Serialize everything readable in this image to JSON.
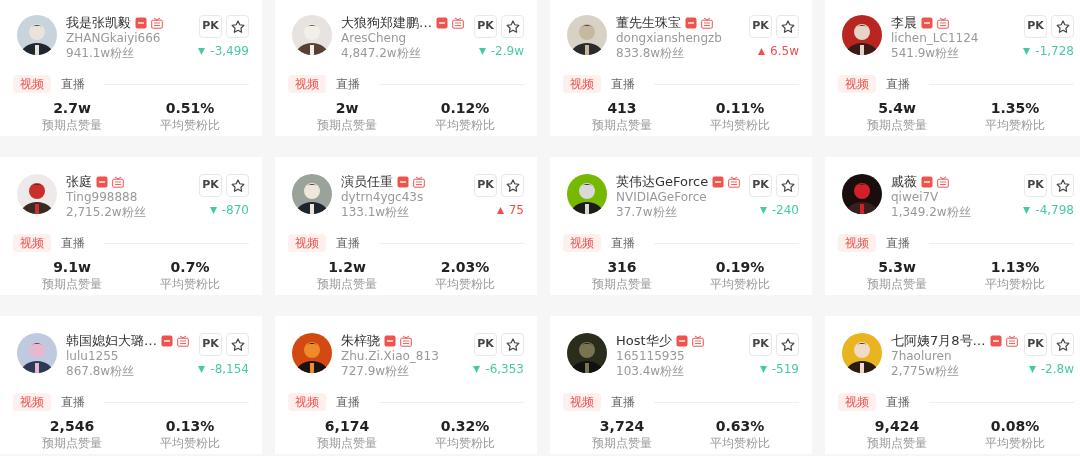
{
  "cards": [
    {
      "name": "我是张凯毅",
      "username": "ZHANGkaiyi666",
      "followers": "941.1w粉丝",
      "pk": "PK",
      "trend": {
        "rising": false,
        "value": "-3,499"
      },
      "tabs": [
        {
          "label": "视频",
          "selected": true
        },
        {
          "label": "直播",
          "selected": false
        }
      ],
      "stats": [
        {
          "value": "2.7w",
          "label": "预期点赞量"
        },
        {
          "value": "0.51%",
          "label": "平均赞粉比"
        }
      ]
    },
    {
      "name": "大狼狗郑建鹏…",
      "username": "AresCheng",
      "followers": "4,847.2w粉丝",
      "pk": "PK",
      "trend": {
        "rising": false,
        "value": "-2.9w"
      },
      "tabs": [
        {
          "label": "视频",
          "selected": true
        },
        {
          "label": "直播",
          "selected": false
        }
      ],
      "stats": [
        {
          "value": "2w",
          "label": "预期点赞量"
        },
        {
          "value": "0.12%",
          "label": "平均赞粉比"
        }
      ]
    },
    {
      "name": "董先生珠宝",
      "username": "dongxianshengzb",
      "followers": "833.8w粉丝",
      "pk": "PK",
      "trend": {
        "rising": true,
        "value": "6.5w"
      },
      "tabs": [
        {
          "label": "视频",
          "selected": true
        },
        {
          "label": "直播",
          "selected": false
        }
      ],
      "stats": [
        {
          "value": "413",
          "label": "预期点赞量"
        },
        {
          "value": "0.11%",
          "label": "平均赞粉比"
        }
      ]
    },
    {
      "name": "李晨",
      "username": "lichen_LC1124",
      "followers": "541.9w粉丝",
      "pk": "PK",
      "trend": {
        "rising": false,
        "value": "-1,728"
      },
      "tabs": [
        {
          "label": "视频",
          "selected": true
        },
        {
          "label": "直播",
          "selected": false
        }
      ],
      "stats": [
        {
          "value": "5.4w",
          "label": "预期点赞量"
        },
        {
          "value": "1.35%",
          "label": "平均赞粉比"
        }
      ]
    },
    {
      "name": "张庭",
      "username": "Ting998888",
      "followers": "2,715.2w粉丝",
      "pk": "PK",
      "trend": {
        "rising": false,
        "value": "-870"
      },
      "tabs": [
        {
          "label": "视频",
          "selected": true
        },
        {
          "label": "直播",
          "selected": false
        }
      ],
      "stats": [
        {
          "value": "9.1w",
          "label": "预期点赞量"
        },
        {
          "value": "0.7%",
          "label": "平均赞粉比"
        }
      ]
    },
    {
      "name": "演员任重",
      "username": "dytrn4ygc43s",
      "followers": "133.1w粉丝",
      "pk": "PK",
      "trend": {
        "rising": true,
        "value": "75"
      },
      "tabs": [
        {
          "label": "视频",
          "selected": true
        },
        {
          "label": "直播",
          "selected": false
        }
      ],
      "stats": [
        {
          "value": "1.2w",
          "label": "预期点赞量"
        },
        {
          "value": "2.03%",
          "label": "平均赞粉比"
        }
      ]
    },
    {
      "name": "英伟达GeForce",
      "username": "NVIDIAGeForce",
      "followers": "37.7w粉丝",
      "pk": "PK",
      "trend": {
        "rising": false,
        "value": "-240"
      },
      "tabs": [
        {
          "label": "视频",
          "selected": true
        },
        {
          "label": "直播",
          "selected": false
        }
      ],
      "stats": [
        {
          "value": "316",
          "label": "预期点赞量"
        },
        {
          "value": "0.19%",
          "label": "平均赞粉比"
        }
      ]
    },
    {
      "name": "戚薇",
      "username": "qiwei7V",
      "followers": "1,349.2w粉丝",
      "pk": "PK",
      "trend": {
        "rising": false,
        "value": "-4,798"
      },
      "tabs": [
        {
          "label": "视频",
          "selected": true
        },
        {
          "label": "直播",
          "selected": false
        }
      ],
      "stats": [
        {
          "value": "5.3w",
          "label": "预期点赞量"
        },
        {
          "value": "1.13%",
          "label": "平均赞粉比"
        }
      ]
    },
    {
      "name": "韩国媳妇大璐…",
      "username": "lulu1255",
      "followers": "867.8w粉丝",
      "pk": "PK",
      "trend": {
        "rising": false,
        "value": "-8,154"
      },
      "tabs": [
        {
          "label": "视频",
          "selected": true
        },
        {
          "label": "直播",
          "selected": false
        }
      ],
      "stats": [
        {
          "value": "2,546",
          "label": "预期点赞量"
        },
        {
          "value": "0.13%",
          "label": "平均赞粉比"
        }
      ]
    },
    {
      "name": "朱梓骁",
      "username": "Zhu.Zi.Xiao_813",
      "followers": "727.9w粉丝",
      "pk": "PK",
      "trend": {
        "rising": false,
        "value": "-6,353"
      },
      "tabs": [
        {
          "label": "视频",
          "selected": true
        },
        {
          "label": "直播",
          "selected": false
        }
      ],
      "stats": [
        {
          "value": "6,174",
          "label": "预期点赞量"
        },
        {
          "value": "0.32%",
          "label": "平均赞粉比"
        }
      ]
    },
    {
      "name": "Host华少",
      "username": "165115935",
      "followers": "103.4w粉丝",
      "pk": "PK",
      "trend": {
        "rising": false,
        "value": "-519"
      },
      "tabs": [
        {
          "label": "视频",
          "selected": true
        },
        {
          "label": "直播",
          "selected": false
        }
      ],
      "stats": [
        {
          "value": "3,724",
          "label": "预期点赞量"
        },
        {
          "value": "0.63%",
          "label": "平均赞粉比"
        }
      ]
    },
    {
      "name": "七阿姨7月8号…",
      "username": "7haoluren",
      "followers": "2,775w粉丝",
      "pk": "PK",
      "trend": {
        "rising": false,
        "value": "-2.8w"
      },
      "tabs": [
        {
          "label": "视频",
          "selected": true
        },
        {
          "label": "直播",
          "selected": false
        }
      ],
      "stats": [
        {
          "value": "9,424",
          "label": "预期点赞量"
        },
        {
          "value": "0.08%",
          "label": "平均赞粉比"
        }
      ]
    }
  ]
}
